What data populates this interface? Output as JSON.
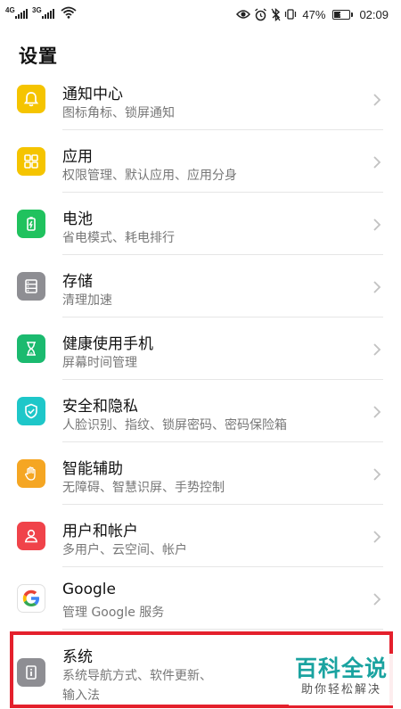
{
  "status_bar": {
    "sim1": "4G",
    "sim2": "3G",
    "battery_text": "47%",
    "battery_level": 0.47,
    "time": "02:09",
    "icons": [
      "signal-icon",
      "wifi-icon",
      "eye-icon",
      "alarm-icon",
      "bluetooth-icon",
      "vibrate-icon",
      "battery-icon"
    ]
  },
  "header": {
    "title": "设置"
  },
  "items": [
    {
      "title": "通知中心",
      "sub": "图标角标、锁屏通知",
      "icon": "bell-icon",
      "color": "#f5c400"
    },
    {
      "title": "应用",
      "sub": "权限管理、默认应用、应用分身",
      "icon": "apps-icon",
      "color": "#f5c400"
    },
    {
      "title": "电池",
      "sub": "省电模式、耗电排行",
      "icon": "battery-icon",
      "color": "#20c25e"
    },
    {
      "title": "存储",
      "sub": "清理加速",
      "icon": "storage-icon",
      "color": "#8e8e93"
    },
    {
      "title": "健康使用手机",
      "sub": "屏幕时间管理",
      "icon": "hourglass-icon",
      "color": "#1bba6f"
    },
    {
      "title": "安全和隐私",
      "sub": "人脸识别、指纹、锁屏密码、密码保险箱",
      "icon": "shield-icon",
      "color": "#1ec7c9"
    },
    {
      "title": "智能辅助",
      "sub": "无障碍、智慧识屏、手势控制",
      "icon": "hand-icon",
      "color": "#f5a623"
    },
    {
      "title": "用户和帐户",
      "sub": "多用户、云空间、帐户",
      "icon": "user-icon",
      "color": "#f0434a"
    },
    {
      "title": "Google",
      "sub": "管理 Google 服务",
      "icon": "google-icon",
      "color": "#ffffff"
    },
    {
      "title": "系统",
      "sub": "系统导航方式、软件更新、",
      "sub2": "输入法",
      "icon": "info-icon",
      "color": "#8e8e93"
    }
  ],
  "watermark": {
    "main": "百科全说",
    "sub": "助你轻松解决"
  },
  "colors": {
    "highlight": "#e4202c",
    "divider": "#e6e6e6",
    "watermark": "#1aa3a0"
  }
}
